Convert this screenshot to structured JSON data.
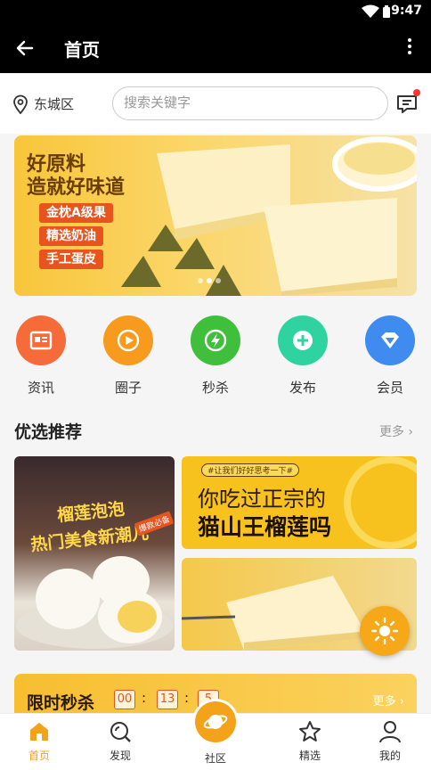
{
  "status_bar": {
    "time": "9:47"
  },
  "nav": {
    "title": "首页",
    "back_icon": "arrow-left-icon",
    "more_icon": "more-vertical-icon"
  },
  "location": {
    "label": "东城区",
    "icon": "location-pin-icon"
  },
  "search": {
    "placeholder": "搜索关键字",
    "value": ""
  },
  "message": {
    "icon": "message-icon",
    "has_unread": true
  },
  "banner": {
    "title_line1": "好原料",
    "title_line2": "造就好味道",
    "tags": [
      "金枕A级果",
      "精选奶油",
      "手工蛋皮"
    ],
    "page_count": 3,
    "active_page": 1
  },
  "quick_links": [
    {
      "label": "资讯",
      "icon": "news-icon",
      "color": "#f56b3a"
    },
    {
      "label": "圈子",
      "icon": "play-circle-icon",
      "color": "#f79a1e"
    },
    {
      "label": "秒杀",
      "icon": "lightning-icon",
      "color": "#3fbf3c"
    },
    {
      "label": "发布",
      "icon": "plus-icon",
      "color": "#2fd3a0"
    },
    {
      "label": "会员",
      "icon": "diamond-icon",
      "color": "#3f8bf0"
    }
  ],
  "recommend": {
    "title": "优选推荐",
    "more": "更多 ›",
    "left_card": {
      "line1": "榴莲泡泡",
      "line2": "热门美食新潮儿",
      "badge": "爆款必备"
    },
    "right_top_card": {
      "hashtag": "#让我们好好思考一下#",
      "line1": "你吃过正宗的",
      "line2": "猫山王榴莲吗"
    }
  },
  "flash_sale": {
    "title": "限时秒杀",
    "countdown": [
      "00",
      "13",
      "5"
    ],
    "more": "更多 ›"
  },
  "tabs": [
    {
      "label": "首页",
      "icon": "home-icon",
      "active": true
    },
    {
      "label": "发现",
      "icon": "discover-icon",
      "active": false
    },
    {
      "label": "社区",
      "icon": "planet-icon",
      "active": false
    },
    {
      "label": "精选",
      "icon": "star-icon",
      "active": false
    },
    {
      "label": "我的",
      "icon": "user-icon",
      "active": false
    }
  ],
  "colors": {
    "accent": "#f5a21b",
    "header": "#000000",
    "tag": "#e8541e"
  }
}
